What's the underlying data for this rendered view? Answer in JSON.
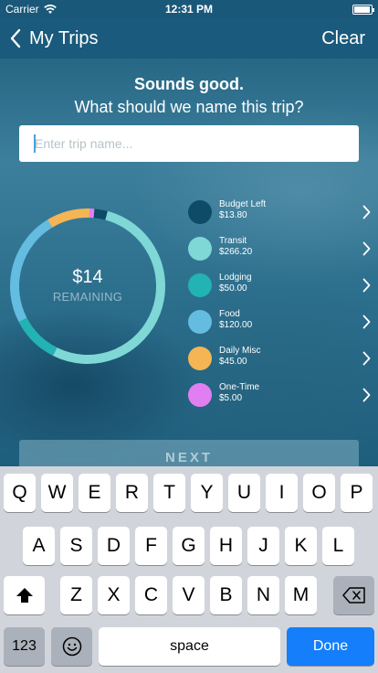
{
  "status_bar": {
    "carrier": "Carrier",
    "time": "12:31 PM"
  },
  "nav": {
    "back_label": "My Trips",
    "clear_label": "Clear"
  },
  "prompt": {
    "line1": "Sounds good.",
    "line2": "What should we name this trip?"
  },
  "trip_name_input": {
    "value": "",
    "placeholder": "Enter trip name..."
  },
  "budget_summary": {
    "amount": "$14",
    "label": "REMAINING"
  },
  "categories": [
    {
      "name": "Budget Left",
      "amount": "$13.80",
      "value": 13.8,
      "color": "#0d4b66"
    },
    {
      "name": "Transit",
      "amount": "$266.20",
      "value": 266.2,
      "color": "#7fd7d6"
    },
    {
      "name": "Lodging",
      "amount": "$50.00",
      "value": 50.0,
      "color": "#22b3b2"
    },
    {
      "name": "Food",
      "amount": "$120.00",
      "value": 120.0,
      "color": "#64bce0"
    },
    {
      "name": "Daily Misc",
      "amount": "$45.00",
      "value": 45.0,
      "color": "#f5b554"
    },
    {
      "name": "One-Time",
      "amount": "$5.00",
      "value": 5.0,
      "color": "#e17ff2"
    }
  ],
  "next_button": {
    "label": "NEXT"
  },
  "keyboard": {
    "row1": [
      "Q",
      "W",
      "E",
      "R",
      "T",
      "Y",
      "U",
      "I",
      "O",
      "P"
    ],
    "row2": [
      "A",
      "S",
      "D",
      "F",
      "G",
      "H",
      "J",
      "K",
      "L"
    ],
    "row3": [
      "Z",
      "X",
      "C",
      "V",
      "B",
      "N",
      "M"
    ],
    "numbers_label": "123",
    "space_label": "space",
    "done_label": "Done",
    "shift_icon": "shift-arrow",
    "delete_icon": "backspace",
    "emoji_icon": "smiley-face"
  }
}
